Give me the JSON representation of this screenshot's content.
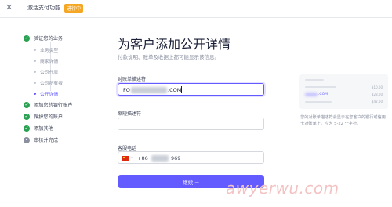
{
  "topbar": {
    "close_icon": "close-icon",
    "title": "激活支付功能",
    "badge": "进行中",
    "badge_color": "#f5a623"
  },
  "steps": [
    {
      "label": "验证您的业务",
      "status": "done"
    },
    {
      "label": "添加您的银行账户",
      "status": "done"
    },
    {
      "label": "保护您的账户",
      "status": "done"
    },
    {
      "label": "添加其他",
      "status": "done"
    },
    {
      "label": "审核并完成",
      "status": "pending"
    }
  ],
  "substeps": [
    {
      "label": "业务类型"
    },
    {
      "label": "商家详情"
    },
    {
      "label": "公司代表"
    },
    {
      "label": "公司所有者"
    },
    {
      "label": "公开详情",
      "active": true
    }
  ],
  "main": {
    "title": "为客户添加公开详情",
    "description": "付款说明、账单及收据上都可能显示该信息。",
    "statement_label": "对账单描述符",
    "statement_value_prefix": "FO",
    "statement_value_suffix": ".COM",
    "short_label": "缩短描述符",
    "short_value": "",
    "phone_label": "客服电话",
    "phone_country_code": "+86",
    "phone_tail": "969",
    "continue_label": "继续 →"
  },
  "preview": {
    "statement_snippet": ".COM",
    "amounts": [
      "$10.00",
      "$28.00",
      "$42.00"
    ]
  },
  "hint": "您的对账单描述符会显示在您客户的银行或信用卡对账单上。应为 5-22 个字符。",
  "watermark": "awyerwu.com",
  "colors": {
    "accent": "#635bff",
    "success": "#2aa152"
  }
}
